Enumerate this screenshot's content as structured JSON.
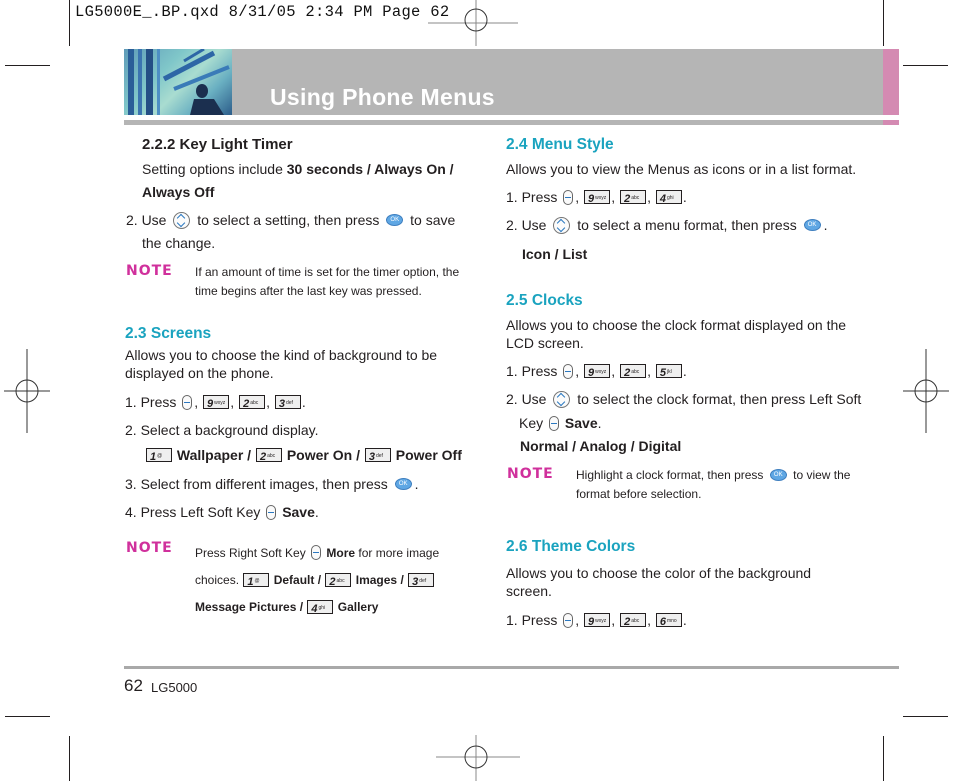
{
  "slug": "LG5000E_.BP.qxd  8/31/05  2:34 PM  Page 62",
  "header": {
    "title": "Using Phone Menus",
    "accent_color": "#d48ab2",
    "bar_color": "#b5b5b5"
  },
  "footer": {
    "page_number": "62",
    "model": "LG5000"
  },
  "left": {
    "key_light": {
      "heading": "2.2.2 Key Light Timer",
      "intro_prefix": "Setting options include ",
      "options_line1": "30 seconds / Always On /",
      "options_line2": "Always Off",
      "step2_a": "2.  Use",
      "step2_b": "to select a setting, then press",
      "step2_c": "to save",
      "step2_d": "the change.",
      "note_label": "NOTE",
      "note_line1": "If an amount of time is set for the timer option, the",
      "note_line2": "time begins after the last key was pressed."
    },
    "screens": {
      "heading": "2.3 Screens",
      "desc_line1": "Allows you to choose the kind of background to be",
      "desc_line2": "displayed on the phone.",
      "step1_label": "1. Press",
      "keys": [
        "9",
        "2",
        "3"
      ],
      "key_subs": [
        "wxyz",
        "abc",
        "def"
      ],
      "step2": "2. Select a background display.",
      "options": [
        {
          "key": "1",
          "sub": "@",
          "label": "Wallpaper /"
        },
        {
          "key": "2",
          "sub": "abc",
          "label": "Power On /"
        },
        {
          "key": "3",
          "sub": "def",
          "label": "Power Off"
        }
      ],
      "step3": "3. Select from different images, then press",
      "step4_a": "4. Press Left Soft Key",
      "step4_b": "Save",
      "note_label": "NOTE",
      "note_a": "Press Right Soft Key",
      "note_more": "More",
      "note_b": "for more image",
      "note_choices": "choices.",
      "note_options": [
        {
          "key": "1",
          "sub": "@",
          "label": "Default /"
        },
        {
          "key": "2",
          "sub": "abc",
          "label": "Images /"
        },
        {
          "key": "3",
          "sub": "def",
          "label": ""
        }
      ],
      "note_msg": "Message Pictures /",
      "note_gallery_key": "4",
      "note_gallery_sub": "ghi",
      "note_gallery": "Gallery"
    }
  },
  "right": {
    "menu_style": {
      "heading": "2.4 Menu Style",
      "desc": "Allows you to view the Menus as icons or in a list format.",
      "step1_label": "1. Press",
      "keys": [
        "9",
        "2",
        "4"
      ],
      "key_subs": [
        "wxyz",
        "abc",
        "ghi"
      ],
      "step2_a": "2. Use",
      "step2_b": "to select a menu format, then press",
      "options": "Icon / List"
    },
    "clocks": {
      "heading": "2.5 Clocks",
      "desc_line1": "Allows you to choose the clock format displayed on the",
      "desc_line2": "LCD screen.",
      "step1_label": "1. Press",
      "keys": [
        "9",
        "2",
        "5"
      ],
      "key_subs": [
        "wxyz",
        "abc",
        "jkl"
      ],
      "step2_a": "2. Use",
      "step2_b": "to select the clock format, then press Left Soft",
      "step2_c": "Key",
      "step2_save": "Save",
      "options": "Normal / Analog / Digital",
      "note_label": "NOTE",
      "note_a": "Highlight a clock format, then press",
      "note_b": "to view the",
      "note_line2": "format before selection."
    },
    "theme": {
      "heading": "2.6 Theme Colors",
      "desc_line1": "Allows you to choose the color of the background",
      "desc_line2": "screen.",
      "step1_label": "1. Press",
      "keys": [
        "9",
        "2",
        "6"
      ],
      "key_subs": [
        "wxyz",
        "abc",
        "mno"
      ]
    }
  },
  "icons": {
    "ok_label": "OK"
  }
}
